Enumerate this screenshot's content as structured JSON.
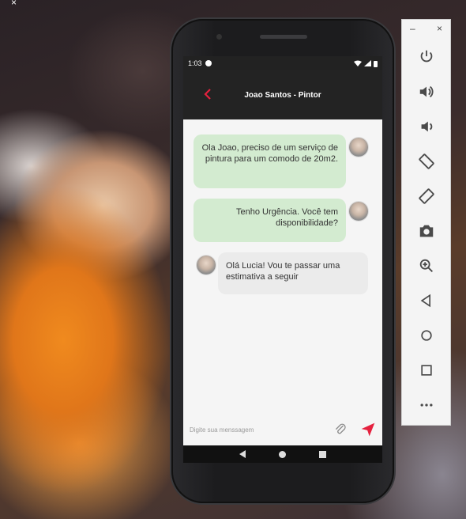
{
  "status": {
    "time": "1:03"
  },
  "header": {
    "back_icon": "chevron-left-icon",
    "title": "Joao Santos - Pintor"
  },
  "messages": [
    {
      "side": "out",
      "text": "Ola Joao, preciso de um serviço de pintura para um comodo de 20m2."
    },
    {
      "side": "out",
      "text": "Tenho Urgência. Você tem disponibilidade?"
    },
    {
      "side": "in",
      "text": "Olá Lucia! Vou te passar uma estimativa a seguir"
    }
  ],
  "composer": {
    "placeholder": "Digite sua menssagem",
    "attach_icon": "paperclip-icon",
    "send_icon": "send-icon"
  },
  "navbar": {
    "back_icon": "triangle-back-icon",
    "home_icon": "circle-home-icon",
    "recents_icon": "square-recents-icon"
  },
  "emulator": {
    "window_controls": {
      "minimize": "–",
      "close": "×"
    },
    "buttons": [
      "power-icon",
      "volume-up-icon",
      "volume-down-icon",
      "rotate-left-icon",
      "rotate-right-icon",
      "camera-icon",
      "zoom-icon",
      "back-icon",
      "home-icon",
      "overview-icon",
      "more-icon"
    ]
  },
  "colors": {
    "accent": "#e5213e",
    "bubble_out": "#d3ebd0",
    "bubble_in": "#ebebeb",
    "appbar": "#232323"
  }
}
